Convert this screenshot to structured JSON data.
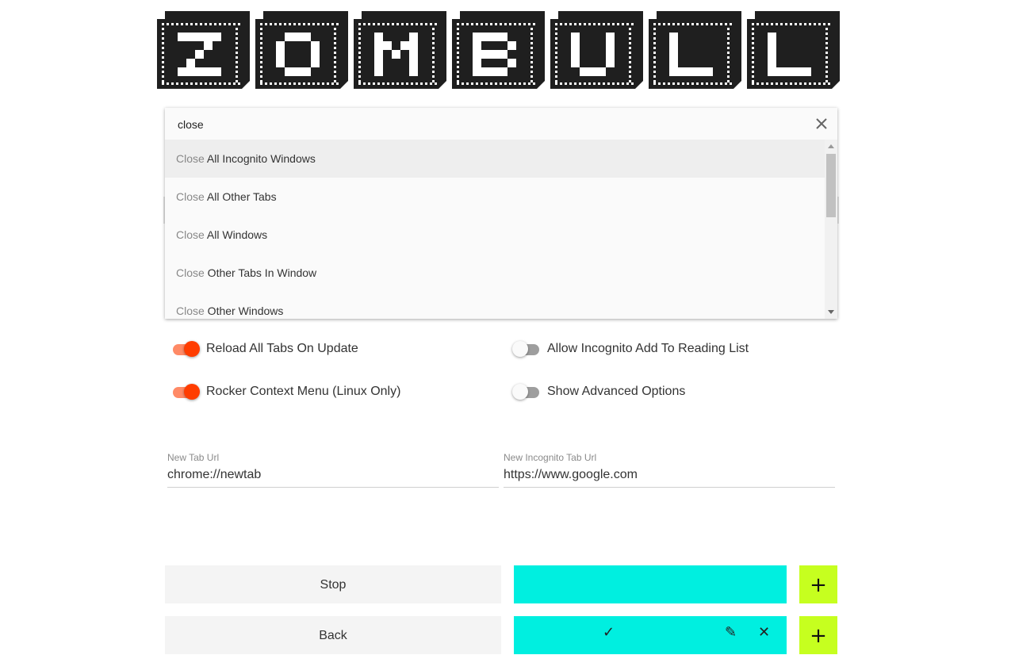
{
  "app": {
    "logo_text": "ZOMBULL",
    "logo_letters": [
      "Z",
      "O",
      "M",
      "B",
      "U",
      "L",
      "L"
    ]
  },
  "search": {
    "value": "close",
    "placeholder": "",
    "results": [
      {
        "match": "Close",
        "rest": " All Incognito Windows",
        "active": true
      },
      {
        "match": "Close",
        "rest": " All Other Tabs",
        "active": false
      },
      {
        "match": "Close",
        "rest": " All Windows",
        "active": false
      },
      {
        "match": "Close",
        "rest": " Other Tabs In Window",
        "active": false
      },
      {
        "match": "Close",
        "rest": " Other Windows",
        "active": false
      }
    ]
  },
  "toggles": [
    {
      "label": "Reload All Tabs On Update",
      "on": true
    },
    {
      "label": "Allow Incognito Add To Reading List",
      "on": false
    },
    {
      "label": "Rocker Context Menu (Linux Only)",
      "on": true
    },
    {
      "label": "Show Advanced Options",
      "on": false
    }
  ],
  "fields": {
    "new_tab": {
      "label": "New Tab Url",
      "value": "chrome://newtab"
    },
    "new_incognito_tab": {
      "label": "New Incognito Tab Url",
      "value": "https://www.google.com"
    }
  },
  "actions": [
    {
      "label": "Stop",
      "plus": "+"
    },
    {
      "label": "Back",
      "plus": "+"
    }
  ],
  "colors": {
    "accent_toggle": "#ff3d00",
    "cyan": "#00efe0",
    "lime": "#c6ff1f",
    "logo": "#1f1f1f"
  },
  "icons": [
    "close-icon",
    "check-icon",
    "pencil-icon",
    "plus-icon"
  ]
}
